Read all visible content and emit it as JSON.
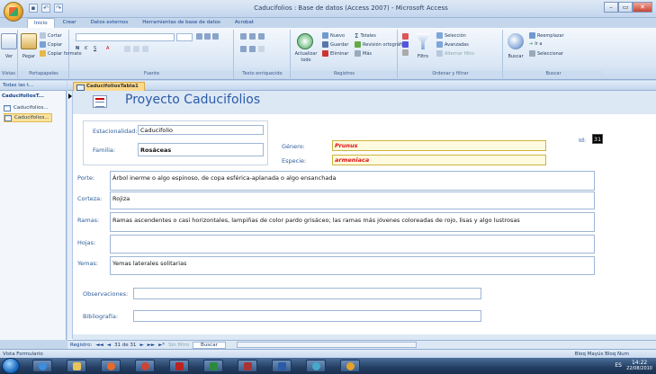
{
  "window": {
    "title": "Caducifolios : Base de datos (Access 2007) - Microsoft Access",
    "controls": [
      "–",
      "▭",
      "✕"
    ]
  },
  "quick_access": [
    "save",
    "undo",
    "redo"
  ],
  "ribbon": {
    "tabs": [
      "Inicio",
      "Crear",
      "Datos externos",
      "Herramientas de base de datos",
      "Acrobat"
    ],
    "active_tab": "Inicio",
    "groups": {
      "vistas": {
        "label": "Vistas",
        "ver": "Ver"
      },
      "portapapeles": {
        "label": "Portapapeles",
        "pegar": "Pegar",
        "cortar": "Cortar",
        "copiar": "Copiar",
        "copiar_formato": "Copiar formato"
      },
      "fuente": {
        "label": "Fuente"
      },
      "texto_enriquecido": {
        "label": "Texto enriquecido"
      },
      "registros": {
        "label": "Registros",
        "actualizar": "Actualizar",
        "todo": "todo",
        "nuevo": "Nuevo",
        "guardar": "Guardar",
        "eliminar": "Eliminar",
        "totales": "Totales",
        "revision": "Revisión ortográfica",
        "mas": "Más"
      },
      "ordenar": {
        "label": "Ordenar y filtrar",
        "filtro": "Filtro",
        "seleccion": "Selección",
        "avanzadas": "Avanzadas",
        "alternar": "Alternar filtro"
      },
      "buscar": {
        "label": "Buscar",
        "buscar": "Buscar",
        "reemplazar": "Reemplazar",
        "ir_a": "Ir a",
        "seleccionar": "Seleccionar"
      }
    }
  },
  "nav": {
    "header": "Todas las t...",
    "section": "CaducifoliosT...",
    "items": [
      "Caducifolios...",
      "Caducifolios..."
    ]
  },
  "document": {
    "tab": "CaducifoliosTabla1",
    "form_title": "Proyecto Caducifolios",
    "fields": {
      "id_label": "Id:",
      "id_value": "31",
      "estacionalidad_label": "Estacionalidad:",
      "estacionalidad_value": "Caducifolio",
      "familia_label": "Familia:",
      "familia_value": "Rosáceas",
      "genero_label": "Género:",
      "genero_value": "Prunus",
      "especie_label": "Especie:",
      "especie_value": "armeniaca",
      "porte_label": "Porte:",
      "porte_value": "Árbol inerme o algo espinoso, de copa esférica-aplanada o algo ensanchada",
      "corteza_label": "Corteza:",
      "corteza_value": "Rojiza",
      "ramas_label": "Ramas:",
      "ramas_value": "Ramas ascendentes o casi horizontales, lampiñas de color pardo grisáceo; las ramas más jóvenes coloreadas de rojo, lisas y algo lustrosas",
      "hojas_label": "Hojas:",
      "hojas_value": "",
      "yemas_label": "Yemas:",
      "yemas_value": "Yemas laterales solitarias",
      "observaciones_label": "Observaciones:",
      "observaciones_value": "",
      "bibliografia_label": "Bibliografía:",
      "bibliografia_value": ""
    }
  },
  "record_nav": {
    "label": "Registro:",
    "first": "◄◄",
    "prev": "◄",
    "position": "31 de 31",
    "next": "►",
    "last": "►►",
    "new": "►*",
    "filter": "Sin filtro",
    "search": "Buscar"
  },
  "status": {
    "left": "Vista Formulario",
    "right": "Bloq Mayús   Bloq Num"
  },
  "taskbar": {
    "tray": "ES",
    "time": "14:22",
    "date": "22/08/2010"
  },
  "colors": {
    "accent": "#2a5ba8",
    "red_text": "#d11111",
    "highlight": "#fbe29d"
  }
}
